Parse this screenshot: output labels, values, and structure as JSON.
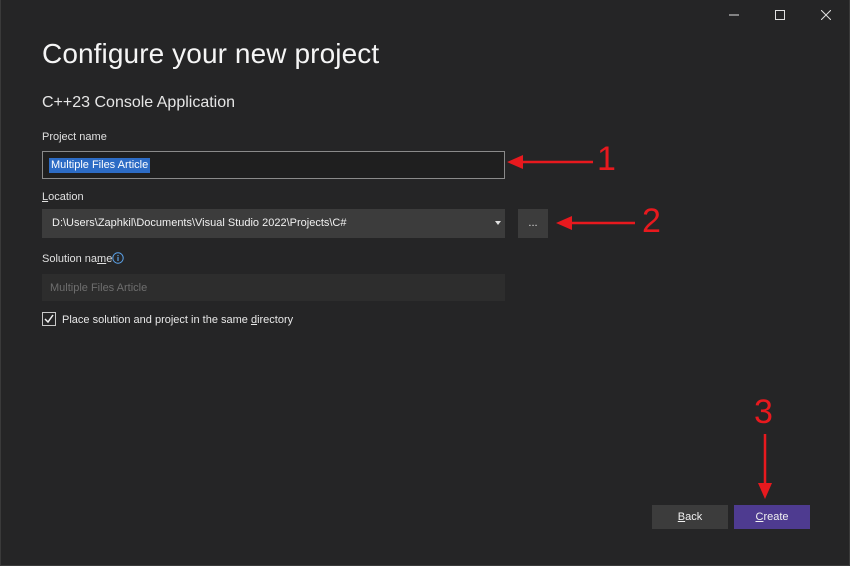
{
  "window": {
    "controls": [
      "minimize-icon",
      "maximize-icon",
      "close-icon"
    ]
  },
  "header": {
    "title": "Configure your new project",
    "subtitle": "C++23 Console Application"
  },
  "form": {
    "project_name_label": "Project name",
    "project_name_value": "Multiple Files Article",
    "location_label_first": "L",
    "location_label_rest": "ocation",
    "location_value": "D:\\Users\\Zaphkil\\Documents\\Visual Studio 2022\\Projects\\C#",
    "browse_label": "...",
    "solution_name_label_pre": "Solution na",
    "solution_name_label_mnemonic": "m",
    "solution_name_label_post": "e",
    "solution_name_value": "Multiple Files Article",
    "same_dir_checked": true,
    "same_dir_label_pre": "Place solution and project in the same ",
    "same_dir_label_mnemonic": "d",
    "same_dir_label_post": "irectory"
  },
  "footer": {
    "back_mnemonic": "B",
    "back_rest": "ack",
    "create_mnemonic": "C",
    "create_rest": "reate"
  },
  "annotations": {
    "one": "1",
    "two": "2",
    "three": "3",
    "color": "#e8191e"
  },
  "colors": {
    "background": "#252526",
    "create_button": "#4e3b90",
    "selection": "#2d6cc5"
  }
}
